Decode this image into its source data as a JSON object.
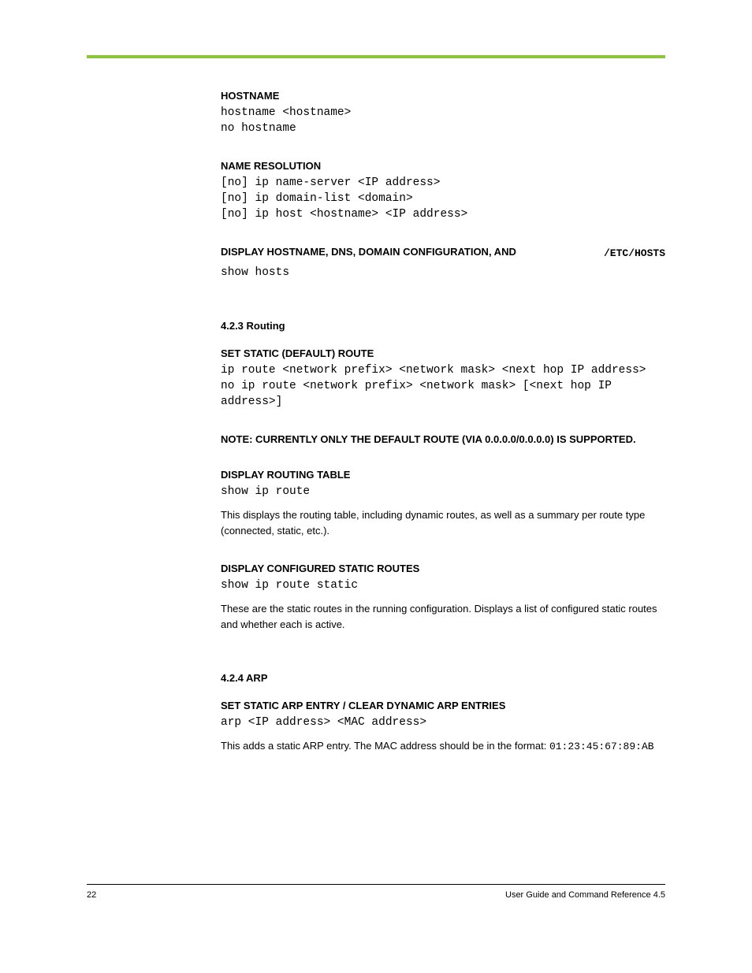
{
  "labels": {
    "hostname_label": "HOSTNAME",
    "name_res_label": "NAME RESOLUTION",
    "hosts_label": "DISPLAY HOSTNAME, DNS, DOMAIN CONFIGURATION, AND",
    "etc_hosts": "/ETC/HOSTS",
    "routing_heading": "4.2.3 Routing",
    "default_gw_label": "SET STATIC (DEFAULT) ROUTE",
    "route_note": "NOTE: CURRENTLY ONLY THE DEFAULT ROUTE (VIA 0.0.0.0/0.0.0.0) IS SUPPORTED.",
    "routing_table_label": "DISPLAY ROUTING TABLE",
    "static_routes_label": "DISPLAY CONFIGURED STATIC ROUTES",
    "arp_heading": "4.2.4 ARP",
    "arp_label": "SET STATIC ARP ENTRY / CLEAR DYNAMIC ARP ENTRIES"
  },
  "code": {
    "hostname": "hostname <hostname>\nno hostname",
    "name_res": "[no] ip name-server <IP address>\n[no] ip domain-list <domain>\n[no] ip host <hostname> <IP address>",
    "show_hosts": "show hosts",
    "ip_route": "ip route <network prefix> <network mask> <next hop IP address>\nno ip route <network prefix> <network mask> [<next hop IP address>]",
    "show_ip_route": "show ip route",
    "show_ip_route_static": "show ip route static",
    "arp": "arp <IP address> <MAC address>"
  },
  "desc": {
    "route1": "This displays the routing table, including dynamic routes, as well as a summary per route type (connected, static, etc.).",
    "route2": "These are the static routes in the running configuration. Displays a list of configured static routes and whether each is active.",
    "arp_desc_prefix": "This adds a static ARP entry. The MAC address should be in the format: ",
    "arp_mac_format": "01:23:45:67:89:AB"
  },
  "footer": {
    "page": "22",
    "title": "User Guide and Command Reference 4.5"
  }
}
